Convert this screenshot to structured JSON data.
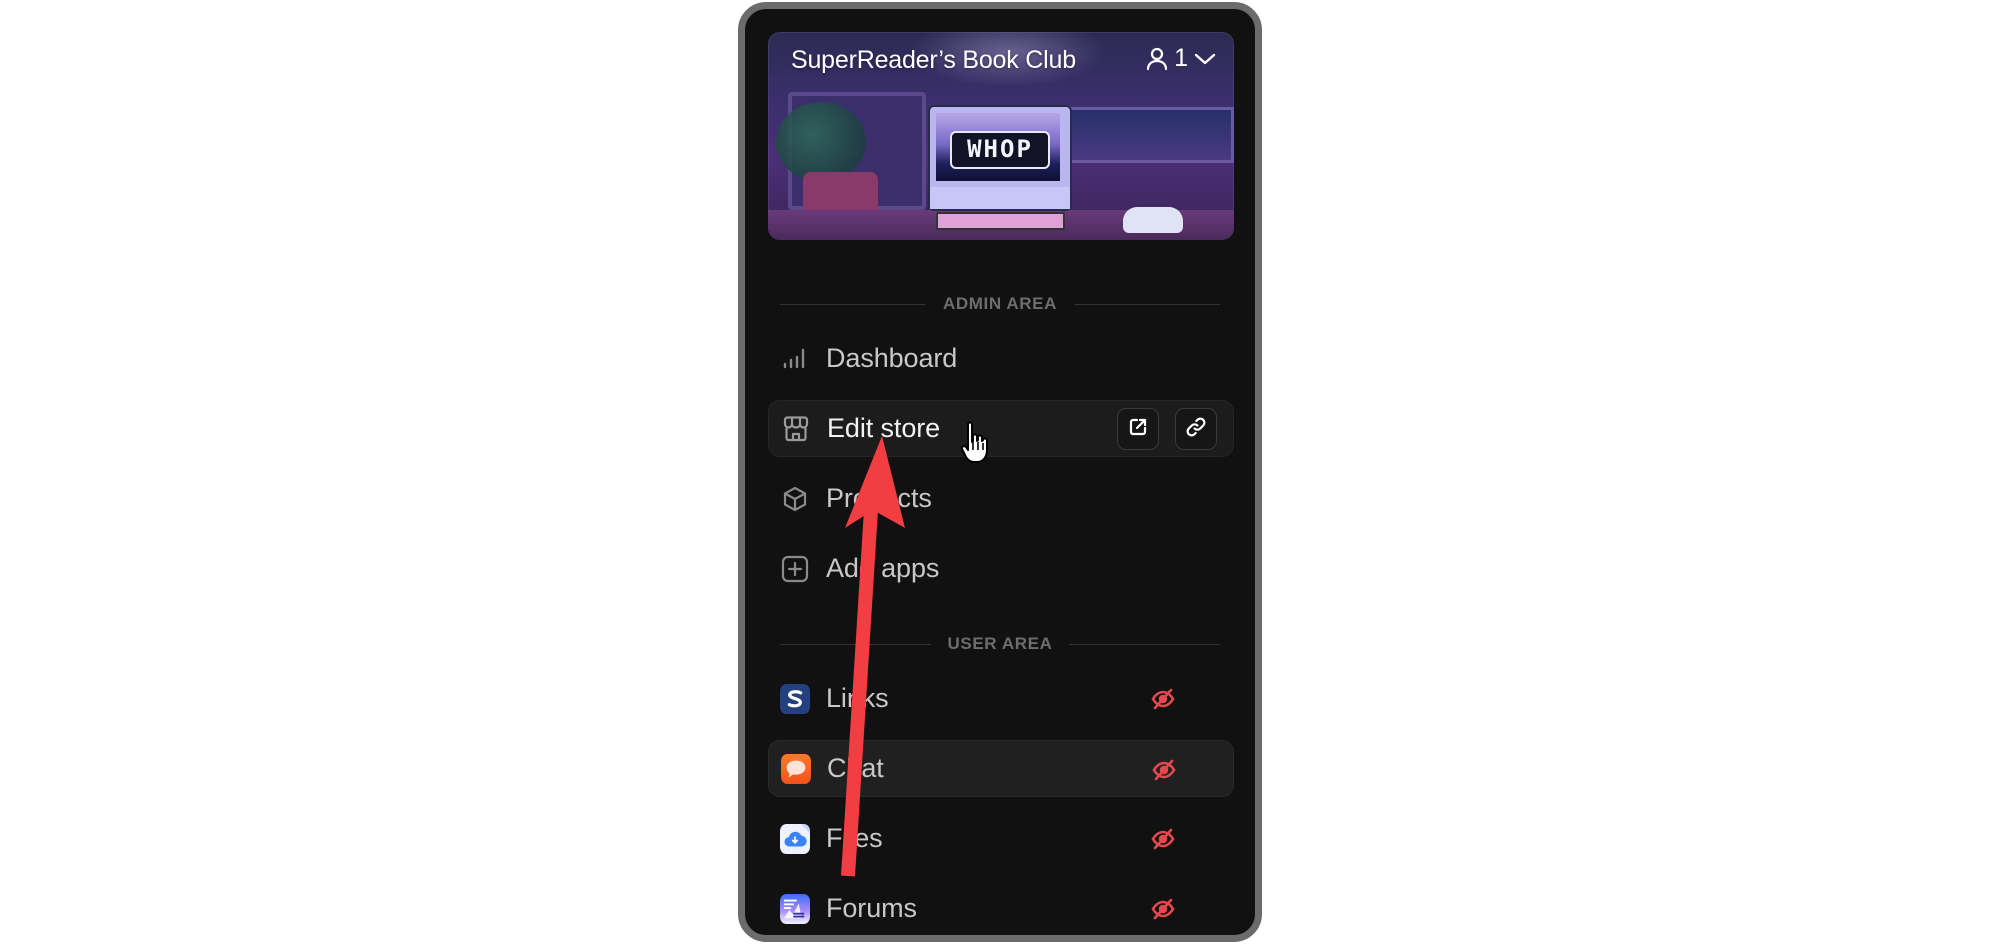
{
  "store": {
    "name": "SuperReader’s Book Club",
    "member_count": "1",
    "banner_logo_text": "WHOP"
  },
  "admin_area": {
    "heading": "ADMIN AREA",
    "items": [
      {
        "label": "Dashboard",
        "icon": "bar-chart-icon"
      },
      {
        "label": "Edit store",
        "icon": "storefront-icon",
        "active": true,
        "actions": [
          {
            "icon": "external-link-icon"
          },
          {
            "icon": "link-icon"
          }
        ]
      },
      {
        "label": "Products",
        "icon": "cube-icon"
      },
      {
        "label": "Add apps",
        "icon": "plus-square-icon"
      }
    ]
  },
  "user_area": {
    "heading": "USER AREA",
    "items": [
      {
        "label": "Links",
        "icon": "links-app-icon",
        "visibility": "hidden"
      },
      {
        "label": "Chat",
        "icon": "chat-app-icon",
        "visibility": "hidden",
        "hovered": true
      },
      {
        "label": "Files",
        "icon": "files-app-icon",
        "visibility": "hidden"
      },
      {
        "label": "Forums",
        "icon": "forums-app-icon",
        "visibility": "hidden"
      }
    ]
  },
  "colors": {
    "panel_bg": "#111111",
    "frame_border": "#6b6b6b",
    "hidden_icon": "#e5484d",
    "annotation_arrow": "#f23d43"
  }
}
